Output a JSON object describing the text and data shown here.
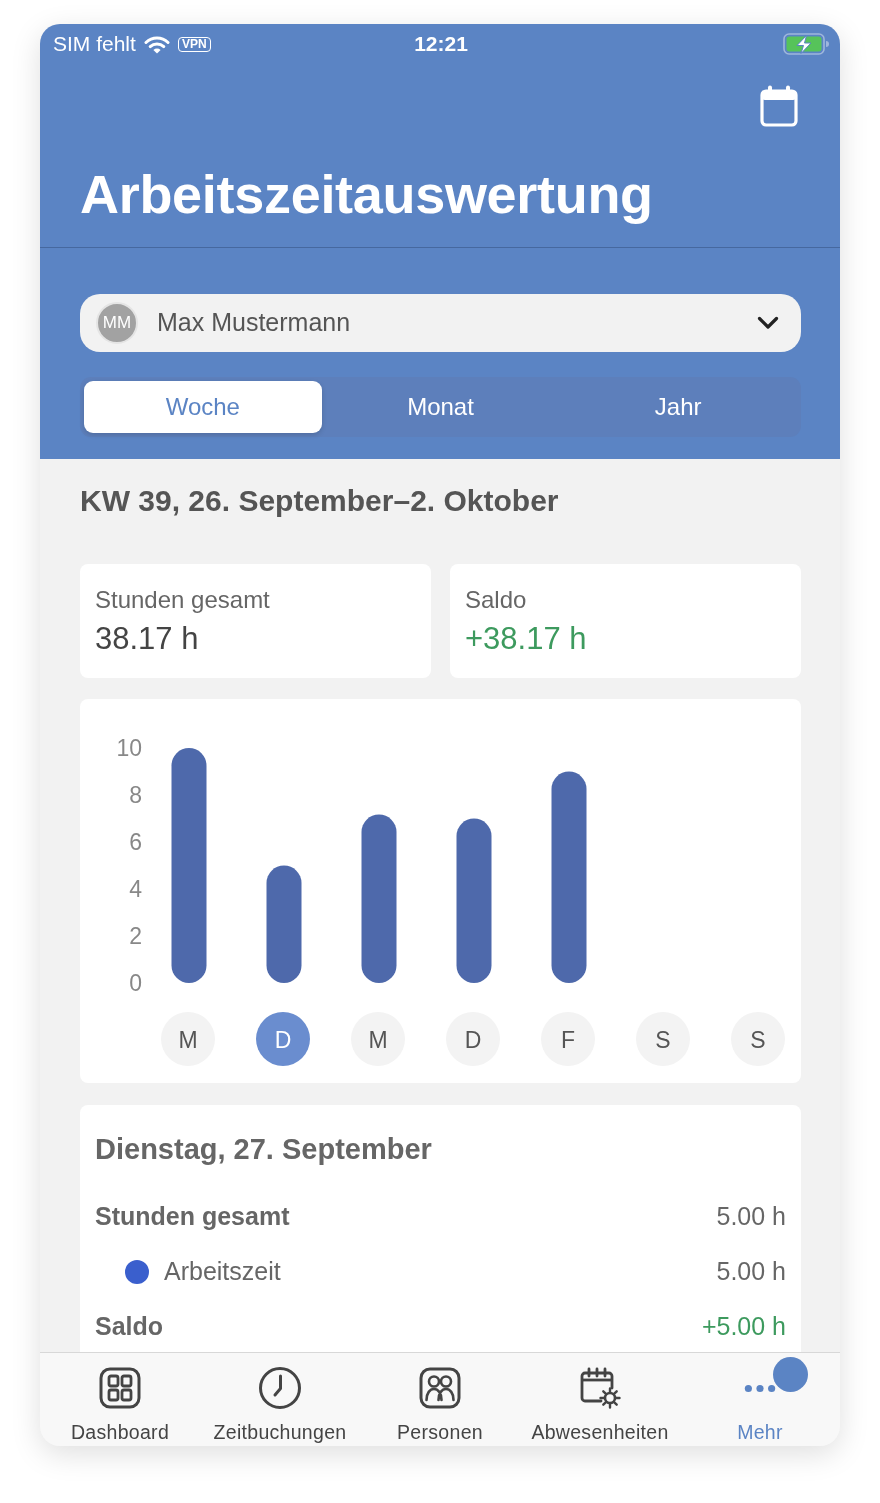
{
  "status_bar": {
    "carrier": "SIM fehlt",
    "vpn": "VPN",
    "time": "12:21"
  },
  "header": {
    "title": "Arbeitszeitauswertung"
  },
  "person_picker": {
    "initials": "MM",
    "name": "Max Mustermann"
  },
  "period_tabs": [
    {
      "label": "Woche",
      "selected": true
    },
    {
      "label": "Monat",
      "selected": false
    },
    {
      "label": "Jahr",
      "selected": false
    }
  ],
  "period_heading": "KW 39, 26. September–2. Oktober",
  "summary": [
    {
      "kind": "total",
      "label": "Stunden gesamt",
      "value": "38.17 h"
    },
    {
      "kind": "balance",
      "label": "Saldo",
      "value": "+38.17 h"
    }
  ],
  "chart": {
    "chart_data": {
      "type": "bar",
      "categories": [
        "M",
        "D",
        "M",
        "D",
        "F",
        "S",
        "S"
      ],
      "values": [
        10,
        5,
        7.17,
        7,
        9,
        0,
        0
      ],
      "ylim": [
        0,
        10
      ],
      "yticks": [
        0,
        2,
        4,
        6,
        8,
        10
      ]
    },
    "days": [
      {
        "selected": false
      },
      {
        "selected": true
      },
      {
        "selected": false
      },
      {
        "selected": false
      },
      {
        "selected": false
      },
      {
        "selected": false
      },
      {
        "selected": false
      }
    ]
  },
  "day_detail": {
    "title": "Dienstag, 27. September",
    "rows": [
      {
        "kind": "total",
        "label": "Stunden gesamt",
        "value": "5.00 h"
      },
      {
        "kind": "category",
        "label": "Arbeitszeit",
        "value": "5.00 h",
        "color": "#3a5fcd"
      },
      {
        "kind": "balance",
        "label": "Saldo",
        "value": "+5.00 h"
      }
    ]
  },
  "tab_bar": [
    {
      "label": "Dashboard",
      "selected": false,
      "badge": false
    },
    {
      "label": "Zeitbuchungen",
      "selected": false,
      "badge": false
    },
    {
      "label": "Personen",
      "selected": false,
      "badge": false
    },
    {
      "label": "Abwesenheiten",
      "selected": false,
      "badge": false
    },
    {
      "label": "Mehr",
      "selected": true,
      "badge": true
    }
  ]
}
